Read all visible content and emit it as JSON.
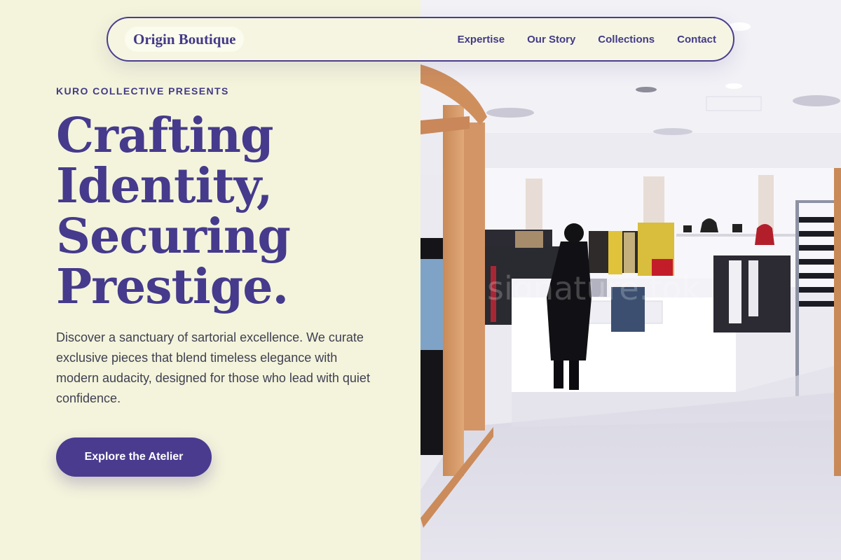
{
  "nav": {
    "brand": "Origin Boutique",
    "links": [
      "Expertise",
      "Our Story",
      "Collections",
      "Contact"
    ]
  },
  "hero": {
    "eyebrow": "KURO COLLECTIVE PRESENTS",
    "headline_lines": [
      "Crafting",
      "Identity,",
      "Securing",
      "Prestige."
    ],
    "body": "Discover a sanctuary of sartorial excellence. We curate exclusive pieces that blend timeless elegance with modern audacity, designed for those who lead with quiet confidence.",
    "cta_label": "Explore the Atelier"
  },
  "photo": {
    "subject": "boutique-interior-photo",
    "watermark": "signature.tok"
  },
  "colors": {
    "background": "#f4f4dc",
    "accent": "#4a3b8f",
    "body_text": "#3f3f52"
  }
}
